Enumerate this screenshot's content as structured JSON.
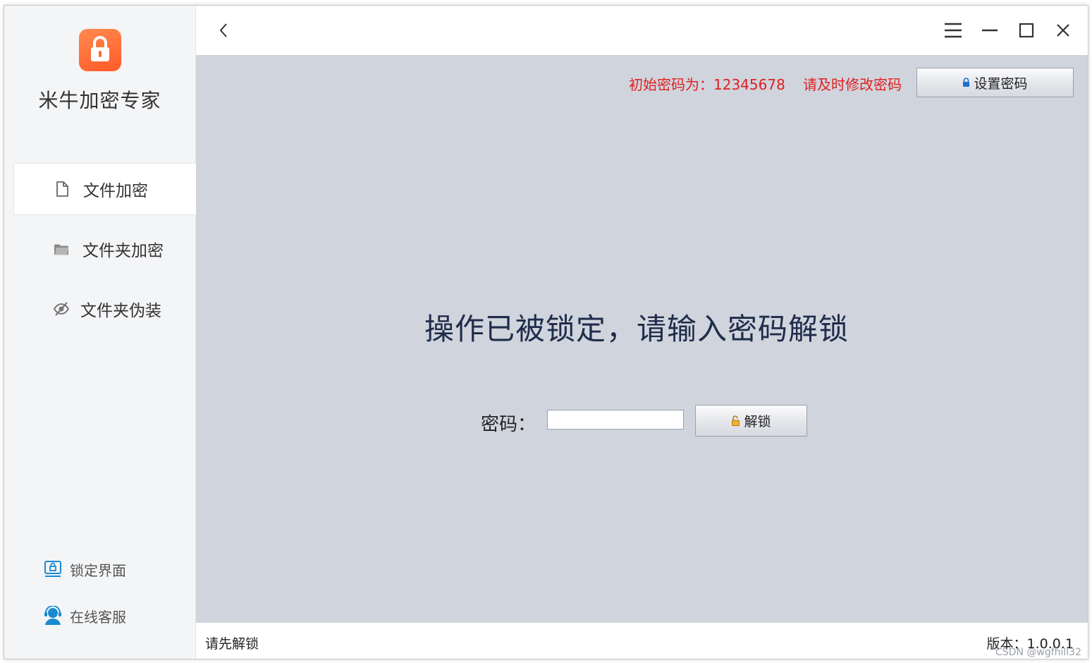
{
  "app": {
    "title": "米牛加密专家",
    "accent_color": "#ff6a33"
  },
  "sidebar": {
    "items": [
      {
        "label": "文件加密",
        "icon": "file-icon",
        "active": true
      },
      {
        "label": "文件夹加密",
        "icon": "folder-icon",
        "active": false
      },
      {
        "label": "文件夹伪装",
        "icon": "eye-slash-icon",
        "active": false
      }
    ],
    "bottom": [
      {
        "label": "锁定界面",
        "icon": "lock-screen-icon"
      },
      {
        "label": "在线客服",
        "icon": "customer-service-icon"
      }
    ]
  },
  "header": {
    "back_icon": "chevron-left-icon",
    "controls": [
      "menu-icon",
      "minimize-icon",
      "maximize-icon",
      "close-icon"
    ]
  },
  "main": {
    "notice_initial_password": "初始密码为：12345678",
    "notice_change_password": "请及时修改密码",
    "notice_color": "#e02020",
    "set_password_label": "设置密码",
    "lock_message": "操作已被锁定，请输入密码解锁",
    "password_label": "密码：",
    "password_value": "",
    "unlock_label": "解锁"
  },
  "status": {
    "left": "请先解锁",
    "version": "版本：1.0.0.1"
  },
  "watermark": "CSDN @wgfhill32"
}
